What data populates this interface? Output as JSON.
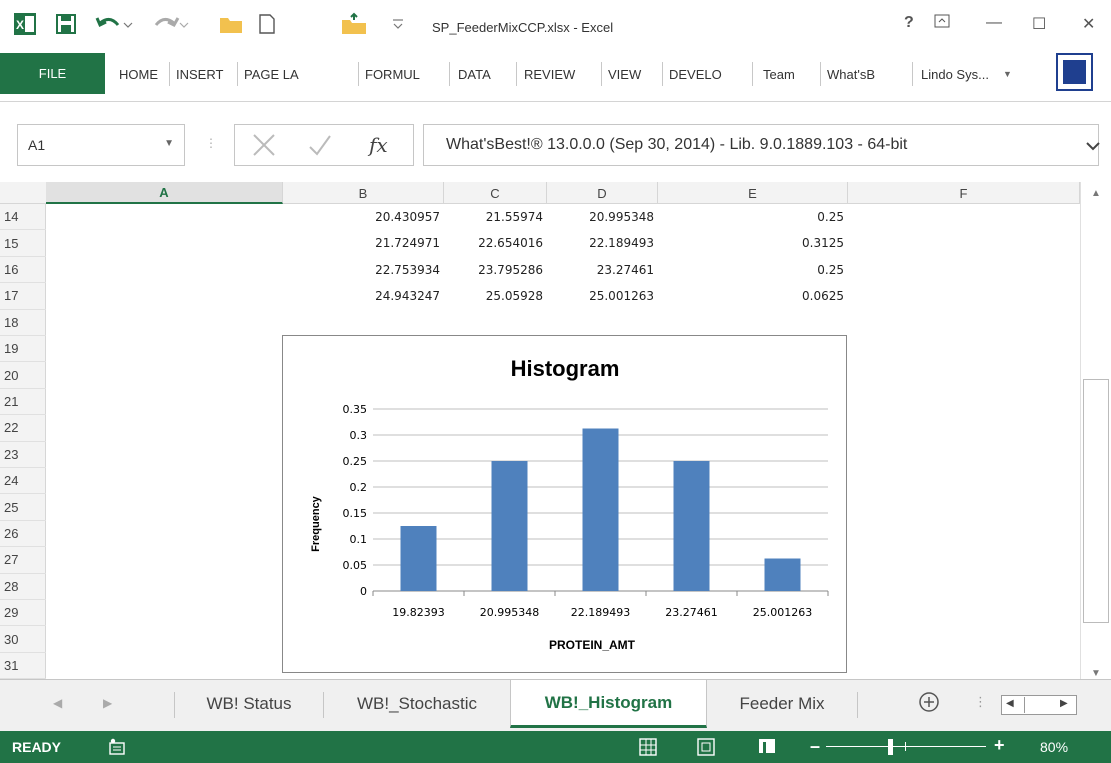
{
  "window": {
    "title": "SP_FeederMixCCP.xlsx - Excel",
    "help": "?",
    "minimize": "—",
    "maximize": "☐",
    "close": "✕"
  },
  "ribbon": {
    "file": "FILE",
    "tabs": [
      "HOME",
      "INSERT",
      "PAGE LA",
      "FORMUL",
      "DATA",
      "REVIEW",
      "VIEW",
      "DEVELO",
      "Team",
      "What'sB"
    ],
    "addin": "Lindo Sys..."
  },
  "formula_bar": {
    "name_box": "A1",
    "fx": "fx",
    "content": "What'sBest!® 13.0.0.0 (Sep 30, 2014) - Lib. 9.0.1889.103 - 64-bit"
  },
  "columns": [
    "A",
    "B",
    "C",
    "D",
    "E",
    "F"
  ],
  "rows": [
    "14",
    "15",
    "16",
    "17",
    "18",
    "19",
    "20",
    "21",
    "22",
    "23",
    "24",
    "25",
    "26",
    "27",
    "28",
    "29",
    "30",
    "31"
  ],
  "cells": [
    {
      "B": "20.430957",
      "C": "21.55974",
      "D": "20.995348",
      "E": "0.25"
    },
    {
      "B": "21.724971",
      "C": "22.654016",
      "D": "22.189493",
      "E": "0.3125"
    },
    {
      "B": "22.753934",
      "C": "23.795286",
      "D": "23.27461",
      "E": "0.25"
    },
    {
      "B": "24.943247",
      "C": "25.05928",
      "D": "25.001263",
      "E": "0.0625"
    }
  ],
  "chart_data": {
    "type": "bar",
    "title": "Histogram",
    "xlabel": "PROTEIN_AMT",
    "ylabel": "Frequency",
    "categories": [
      "19.82393",
      "20.995348",
      "22.189493",
      "23.27461",
      "25.001263"
    ],
    "values": [
      0.125,
      0.25,
      0.3125,
      0.25,
      0.0625
    ],
    "ylim": [
      0,
      0.35
    ],
    "yticks": [
      "0",
      "0.05",
      "0.1",
      "0.15",
      "0.2",
      "0.25",
      "0.3",
      "0.35"
    ],
    "grid": true,
    "bar_color": "#4f81bd"
  },
  "sheets": [
    "WB! Status",
    "WB!_Stochastic",
    "WB!_Histogram",
    "Feeder Mix"
  ],
  "active_sheet": "WB!_Histogram",
  "status": {
    "ready": "READY",
    "zoom": "80%"
  },
  "colors": {
    "accent": "#217346",
    "bar": "#4f81bd"
  }
}
